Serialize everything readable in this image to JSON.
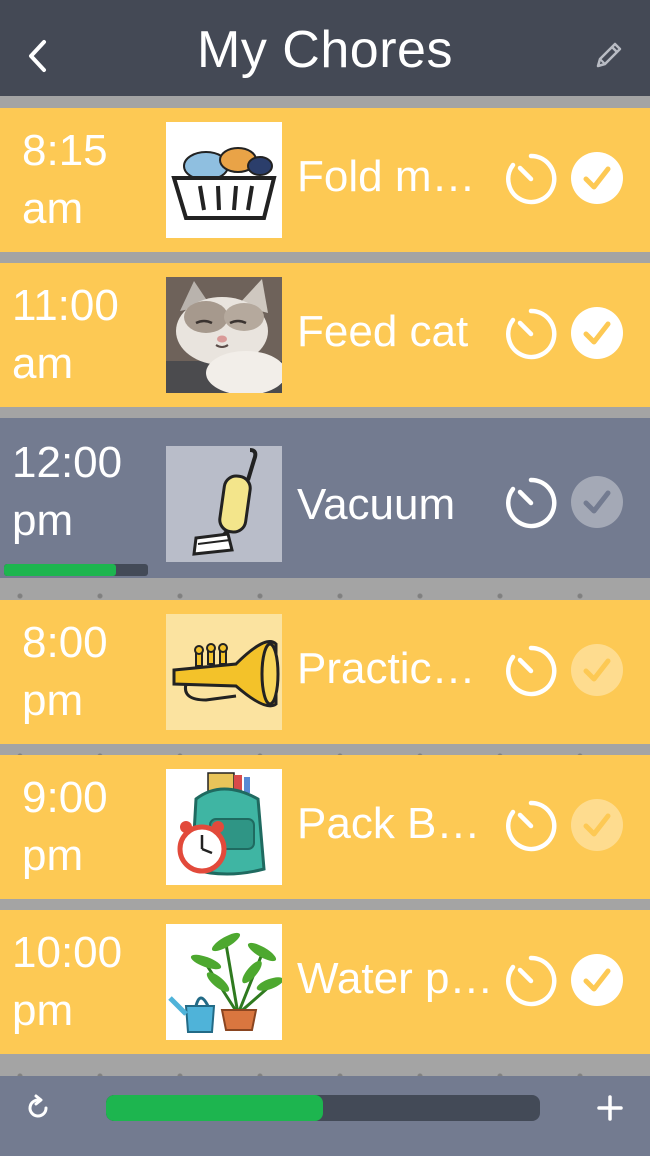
{
  "header": {
    "title": "My Chores",
    "back_icon": "chevron-left-icon",
    "edit_icon": "pencil-icon"
  },
  "colors": {
    "header_bg": "#444955",
    "row_pending": "#fdc954",
    "row_active": "#737b90",
    "progress_green": "#1db54f",
    "progress_track": "#434a57"
  },
  "chores": [
    {
      "time_line1": "8:15",
      "time_line2": "am",
      "label": "Fold my clothes",
      "image": "laundry-basket",
      "done": true,
      "active": false
    },
    {
      "time_line1": "11:00",
      "time_line2": "am",
      "label": "Feed cat",
      "image": "cat-photo",
      "done": true,
      "active": false
    },
    {
      "time_line1": "12:00",
      "time_line2": "pm",
      "label": "Vacuum",
      "image": "vacuum",
      "done": false,
      "active": true,
      "progress": 0.78
    },
    {
      "time_line1": "8:00",
      "time_line2": "pm",
      "label": "Practice trumpet",
      "image": "trumpet",
      "done": false,
      "active": false
    },
    {
      "time_line1": "9:00",
      "time_line2": "pm",
      "label": "Pack Backpack",
      "image": "backpack",
      "done": false,
      "active": false
    },
    {
      "time_line1": "10:00",
      "time_line2": "pm",
      "label": "Water plants",
      "image": "plant",
      "done": true,
      "active": false
    }
  ],
  "footer": {
    "refresh_icon": "refresh-icon",
    "add_icon": "plus-icon",
    "overall_progress": 0.5
  }
}
